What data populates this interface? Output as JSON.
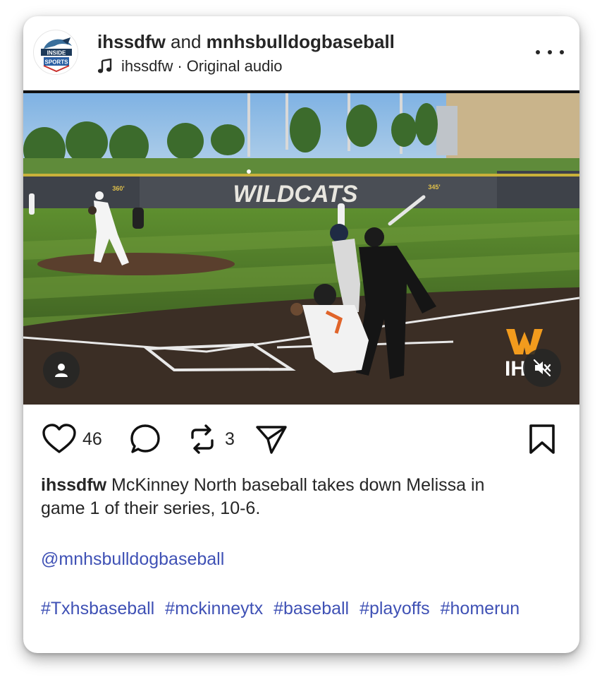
{
  "header": {
    "author_primary": "ihssdfw",
    "connector": "and",
    "author_secondary": "mnhsbulldogbaseball",
    "audio_owner": "ihssdfw",
    "audio_separator": "·",
    "audio_label": "Original audio",
    "avatar_text_top": "INSIDE",
    "avatar_text_bottom": "SPORTS"
  },
  "media": {
    "scoreboard_text": "WILDCATS",
    "distance_left": "360'",
    "distance_right": "345'",
    "watermark_text": "IH"
  },
  "actions": {
    "likes": "46",
    "reposts": "3"
  },
  "caption": {
    "username": "ihssdfw",
    "text_line1": " McKinney North baseball takes down Melissa in",
    "text_line2": "game 1 of their series, 10-6.",
    "mention": "@mnhsbulldogbaseball",
    "hashtags": [
      "#Txhsbaseball",
      "#mckinneytx",
      "#baseball",
      "#playoffs",
      "#homerun"
    ]
  },
  "colors": {
    "link": "#3f51b5",
    "text": "#262626",
    "grass": "#4f7a2a",
    "wall": "#4a4e55"
  }
}
